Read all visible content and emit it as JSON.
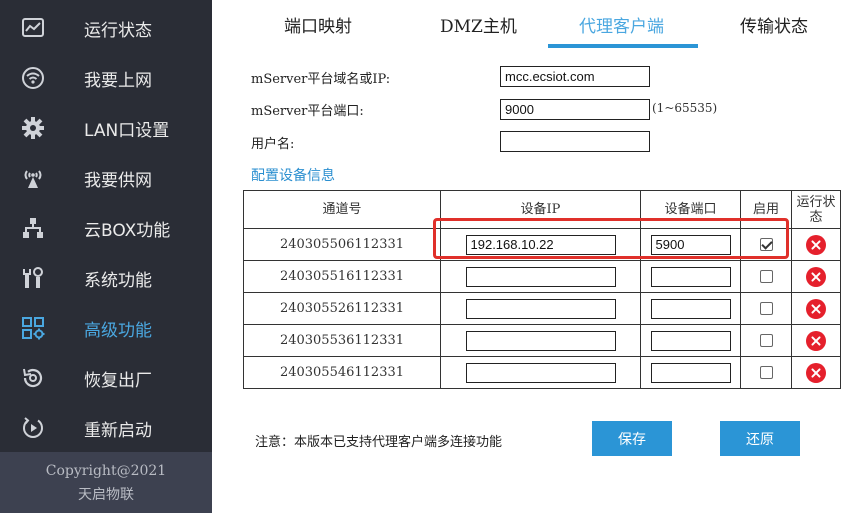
{
  "sidebar": {
    "items": [
      {
        "label": "运行状态",
        "icon": "monitor-chart-icon"
      },
      {
        "label": "我要上网",
        "icon": "wifi-icon"
      },
      {
        "label": "LAN口设置",
        "icon": "gear-icon"
      },
      {
        "label": "我要供网",
        "icon": "antenna-icon"
      },
      {
        "label": "云BOX功能",
        "icon": "network-tree-icon"
      },
      {
        "label": "系统功能",
        "icon": "tools-icon"
      },
      {
        "label": "高级功能",
        "icon": "grid-gear-icon"
      },
      {
        "label": "恢复出厂",
        "icon": "restore-icon"
      },
      {
        "label": "重新启动",
        "icon": "power-icon"
      }
    ],
    "active_index": 6,
    "copyright_line1": "Copyright@2021",
    "copyright_line2": "天启物联"
  },
  "tabs": [
    {
      "label": "端口映射"
    },
    {
      "label": "DMZ主机"
    },
    {
      "label": "代理客户端"
    },
    {
      "label": "传输状态"
    }
  ],
  "active_tab": 2,
  "form": {
    "domain_label": "mServer平台域名或IP:",
    "domain_value": "mcc.ecsiot.com",
    "port_label": "mServer平台端口:",
    "port_value": "9000",
    "port_hint": "(1~65535)",
    "username_label": "用户名:",
    "username_value": ""
  },
  "config_link": "配置设备信息",
  "table": {
    "headers": [
      "通道号",
      "设备IP",
      "设备端口",
      "启用",
      "运行状态"
    ],
    "rows": [
      {
        "channel": "240305506112331",
        "ip": "192.168.10.22",
        "port": "5900",
        "enabled": true
      },
      {
        "channel": "240305516112331",
        "ip": "",
        "port": "",
        "enabled": false
      },
      {
        "channel": "240305526112331",
        "ip": "",
        "port": "",
        "enabled": false
      },
      {
        "channel": "240305536112331",
        "ip": "",
        "port": "",
        "enabled": false
      },
      {
        "channel": "240305546112331",
        "ip": "",
        "port": "",
        "enabled": false
      }
    ]
  },
  "note": "注意：本版本已支持代理客户端多连接功能",
  "buttons": {
    "save": "保存",
    "restore": "还原"
  },
  "colors": {
    "sidebar_bg": "#2a2d36",
    "accent": "#2b95d6",
    "highlight": "#e0302a",
    "status_error": "#e5202c"
  }
}
